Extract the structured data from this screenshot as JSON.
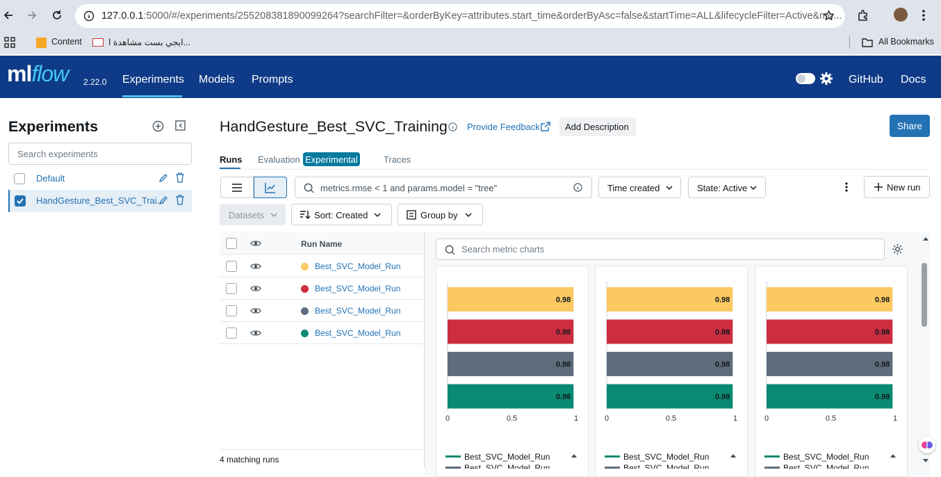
{
  "browser": {
    "url_host": "127.0.0.1",
    "url_rest": ":5000/#/experiments/255208381890099264?searchFilter=&orderByKey=attributes.start_time&orderByAsc=false&startTime=ALL&lifecycleFilter=Active&mo...",
    "bookmarks": [
      "Content",
      "ايجي بست مشاهدة ا..."
    ],
    "all_bookmarks": "All Bookmarks"
  },
  "header": {
    "logo": "mlflow",
    "version": "2.22.0",
    "nav": [
      "Experiments",
      "Models",
      "Prompts"
    ],
    "right_links": [
      "GitHub",
      "Docs"
    ]
  },
  "sidebar": {
    "title": "Experiments",
    "search_placeholder": "Search experiments",
    "items": [
      {
        "label": "Default",
        "checked": false
      },
      {
        "label": "HandGesture_Best_SVC_Trai...",
        "checked": true
      }
    ]
  },
  "main": {
    "title": "HandGesture_Best_SVC_Training",
    "feedback": "Provide Feedback",
    "add_description": "Add Description",
    "share": "Share",
    "tabs": [
      "Runs",
      "Evaluation",
      "Experimental",
      "Traces"
    ],
    "filter_text": "metrics.rmse < 1 and params.model = \"tree\"",
    "time_created": "Time created",
    "state": "State: Active",
    "new_run": "New run",
    "datasets": "Datasets",
    "sort": "Sort: Created",
    "group_by": "Group by"
  },
  "runs": {
    "header": "Run Name",
    "rows": [
      {
        "name": "Best_SVC_Model_Run",
        "color": "#fcc862"
      },
      {
        "name": "Best_SVC_Model_Run",
        "color": "#cc2d3f"
      },
      {
        "name": "Best_SVC_Model_Run",
        "color": "#5f6c7b"
      },
      {
        "name": "Best_SVC_Model_Run",
        "color": "#0a8a73"
      }
    ],
    "matching": "4 matching runs"
  },
  "charts": {
    "search_placeholder": "Search metric charts",
    "legend_first": "Best_SVC_Model_Run",
    "legend_partial": "Best_SVC_Model_Run"
  },
  "chart_data": [
    {
      "type": "bar",
      "orientation": "horizontal",
      "series": [
        {
          "name": "Best_SVC_Model_Run",
          "color": "#fcc862",
          "value": 0.98
        },
        {
          "name": "Best_SVC_Model_Run",
          "color": "#cc2d3f",
          "value": 0.98
        },
        {
          "name": "Best_SVC_Model_Run",
          "color": "#5f6c7b",
          "value": 0.98
        },
        {
          "name": "Best_SVC_Model_Run",
          "color": "#0a8a73",
          "value": 0.98
        }
      ],
      "xlim": [
        0,
        1
      ],
      "xticks": [
        "0",
        "0.5",
        "1"
      ],
      "grid": false
    },
    {
      "type": "bar",
      "orientation": "horizontal",
      "series": [
        {
          "name": "Best_SVC_Model_Run",
          "color": "#fcc862",
          "value": 0.98
        },
        {
          "name": "Best_SVC_Model_Run",
          "color": "#cc2d3f",
          "value": 0.98
        },
        {
          "name": "Best_SVC_Model_Run",
          "color": "#5f6c7b",
          "value": 0.98
        },
        {
          "name": "Best_SVC_Model_Run",
          "color": "#0a8a73",
          "value": 0.98
        }
      ],
      "xlim": [
        0,
        1
      ],
      "xticks": [
        "0",
        "0.5",
        "1"
      ],
      "grid": false
    },
    {
      "type": "bar",
      "orientation": "horizontal",
      "series": [
        {
          "name": "Best_SVC_Model_Run",
          "color": "#fcc862",
          "value": 0.98
        },
        {
          "name": "Best_SVC_Model_Run",
          "color": "#cc2d3f",
          "value": 0.98
        },
        {
          "name": "Best_SVC_Model_Run",
          "color": "#5f6c7b",
          "value": 0.98
        },
        {
          "name": "Best_SVC_Model_Run",
          "color": "#0a8a73",
          "value": 0.98
        }
      ],
      "xlim": [
        0,
        1
      ],
      "xticks": [
        "0",
        "0.5",
        "1"
      ],
      "grid": false
    }
  ]
}
